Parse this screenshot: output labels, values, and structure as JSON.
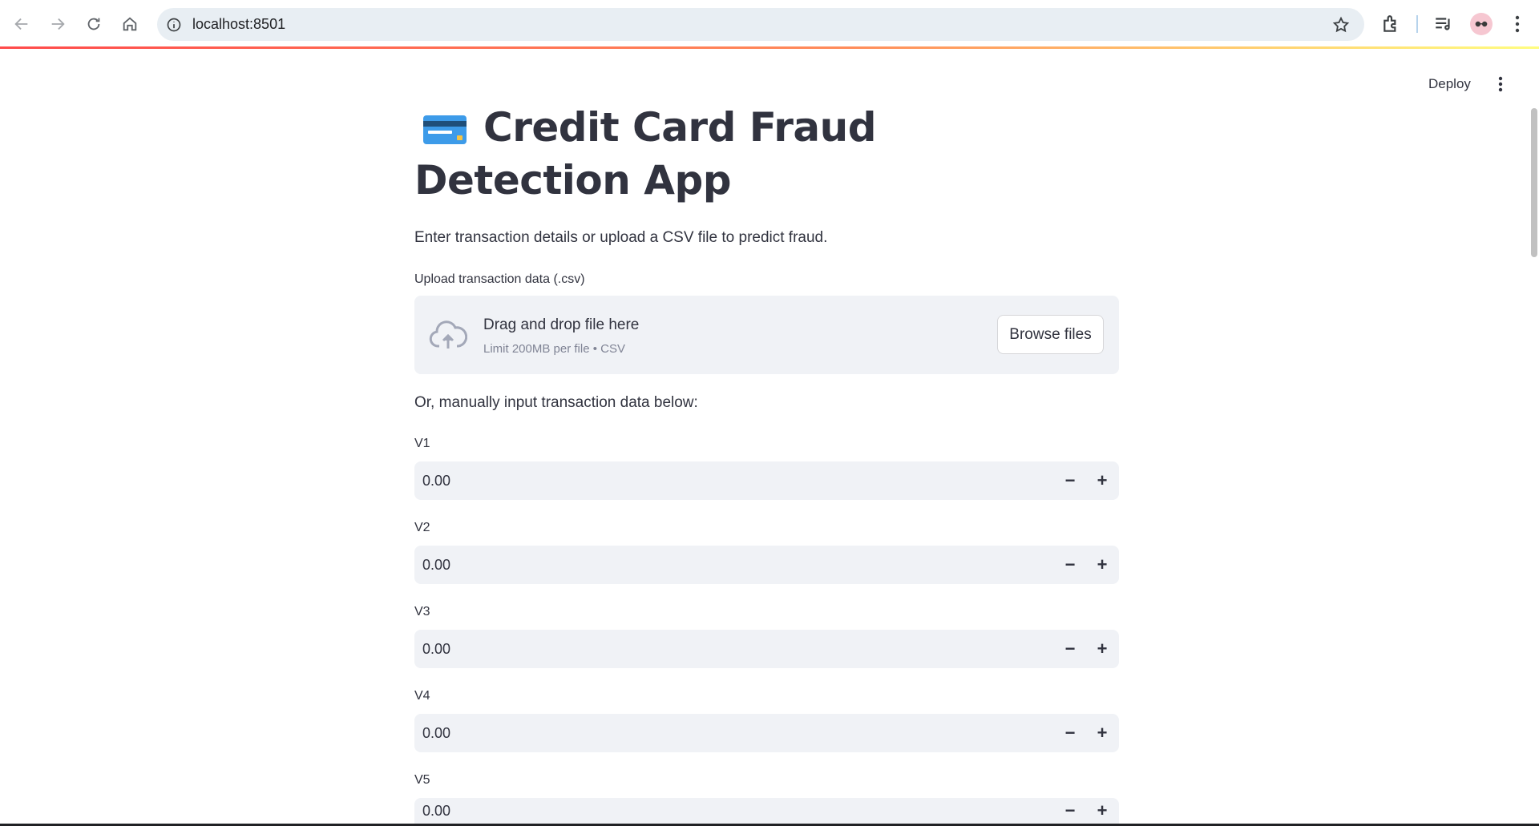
{
  "browser": {
    "url": "localhost:8501"
  },
  "header": {
    "deploy_label": "Deploy"
  },
  "app": {
    "title": "Credit Card Fraud Detection App",
    "title_icon": "credit-card-emoji",
    "description": "Enter transaction details or upload a CSV file to predict fraud.",
    "uploader": {
      "label": "Upload transaction data (.csv)",
      "drop_text": "Drag and drop file here",
      "limit_text": "Limit 200MB per file • CSV",
      "browse_label": "Browse files"
    },
    "manual_text": "Or, manually input transaction data below:",
    "inputs": [
      {
        "label": "V1",
        "value": "0.00"
      },
      {
        "label": "V2",
        "value": "0.00"
      },
      {
        "label": "V3",
        "value": "0.00"
      },
      {
        "label": "V4",
        "value": "0.00"
      },
      {
        "label": "V5",
        "value": "0.00"
      }
    ],
    "stepper": {
      "minus": "−",
      "plus": "+"
    }
  },
  "colors": {
    "accent_gradient_start": "#ff4b4b",
    "accent_gradient_end": "#fffd80",
    "input_bg": "#f0f2f6",
    "text": "#31333f"
  }
}
